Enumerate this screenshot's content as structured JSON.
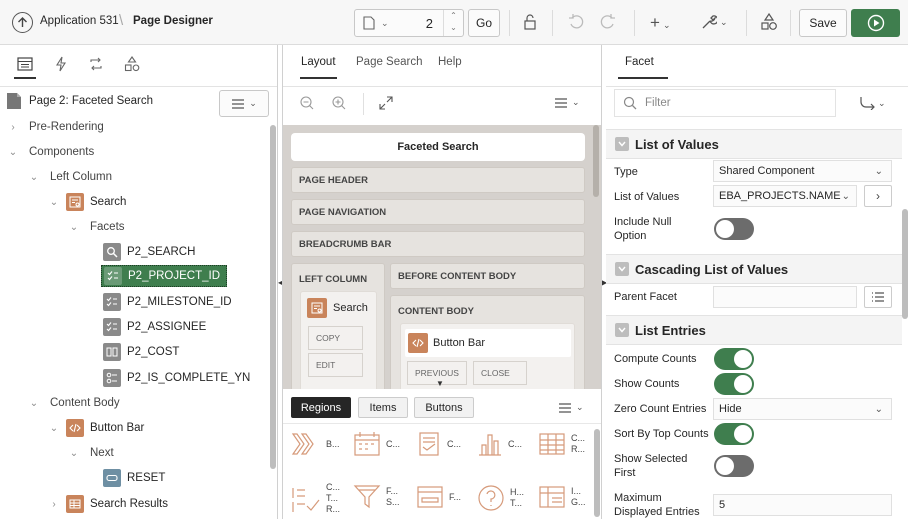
{
  "header": {
    "app_label": "Application 531",
    "page_designer": "Page Designer",
    "page_number": "2",
    "go_label": "Go",
    "save_label": "Save"
  },
  "left": {
    "page_title": "Page 2: Faceted Search",
    "tree": [
      {
        "label": "Pre-Rendering"
      },
      {
        "label": "Components"
      },
      {
        "label": "Left Column"
      },
      {
        "label": "Search"
      },
      {
        "label": "Facets"
      },
      {
        "label": "P2_SEARCH"
      },
      {
        "label": "P2_PROJECT_ID"
      },
      {
        "label": "P2_MILESTONE_ID"
      },
      {
        "label": "P2_ASSIGNEE"
      },
      {
        "label": "P2_COST"
      },
      {
        "label": "P2_IS_COMPLETE_YN"
      },
      {
        "label": "Content Body"
      },
      {
        "label": "Button Bar"
      },
      {
        "label": "Next"
      },
      {
        "label": "RESET"
      },
      {
        "label": "Search Results"
      }
    ]
  },
  "middle": {
    "tabs": [
      "Layout",
      "Page Search",
      "Help"
    ],
    "page_name": "Faceted Search",
    "regions": {
      "page_header": "PAGE HEADER",
      "page_navigation": "PAGE NAVIGATION",
      "breadcrumb_bar": "BREADCRUMB BAR",
      "left_column": "LEFT COLUMN",
      "before_content_body": "BEFORE CONTENT BODY",
      "content_body": "CONTENT BODY"
    },
    "search_card": "Search",
    "copy": "COPY",
    "edit": "EDIT",
    "button_bar_card": "Button Bar",
    "previous": "PREVIOUS",
    "close": "CLOSE",
    "gallery_tabs": [
      "Regions",
      "Items",
      "Buttons"
    ],
    "gallery": [
      {
        "label": "B..."
      },
      {
        "label": "C..."
      },
      {
        "label": "C..."
      },
      {
        "label": "C..."
      },
      {
        "label": "C... R..."
      },
      {
        "label": "C... T... R..."
      },
      {
        "label": "F... S..."
      },
      {
        "label": "F..."
      },
      {
        "label": "H... T..."
      },
      {
        "label": "I... G..."
      }
    ]
  },
  "right": {
    "tab": "Facet",
    "filter_placeholder": "Filter",
    "sections": {
      "lov": "List of Values",
      "cascading": "Cascading List of Values",
      "entries": "List Entries"
    },
    "fields": {
      "type_label": "Type",
      "type_value": "Shared Component",
      "lov_label": "List of Values",
      "lov_value": "EBA_PROJECTS.NAME",
      "include_null_label": "Include Null Option",
      "parent_facet_label": "Parent Facet",
      "compute_counts_label": "Compute Counts",
      "show_counts_label": "Show Counts",
      "zero_count_label": "Zero Count Entries",
      "zero_count_value": "Hide",
      "sort_top_label": "Sort By Top Counts",
      "show_selected_label": "Show Selected First",
      "max_entries_label": "Maximum Displayed Entries",
      "max_entries_value": "5"
    }
  }
}
